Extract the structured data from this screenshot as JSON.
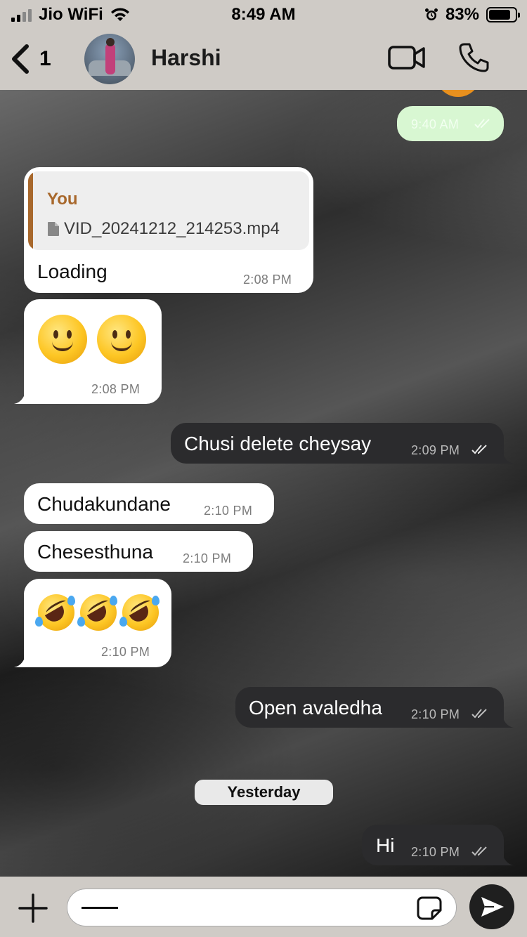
{
  "status_bar": {
    "carrier": "Jio WiFi",
    "time": "8:49 AM",
    "battery_percent": "83%",
    "battery_level": 0.83
  },
  "header": {
    "back_count": "1",
    "contact_name": "Harshi"
  },
  "messages": [
    {
      "direction": "out",
      "text": "",
      "time": "9:40 AM",
      "ticks": "read"
    },
    {
      "direction": "in",
      "reply_to": {
        "author": "You",
        "file_icon": "document-icon",
        "file_name": "VID_20241212_214253.mp4"
      },
      "text": "Loading",
      "time": "2:08 PM"
    },
    {
      "direction": "in",
      "emoji": [
        "slightly-smiling-face",
        "slightly-smiling-face"
      ],
      "time": "2:08 PM"
    },
    {
      "direction": "out",
      "text": "Chusi delete cheysay",
      "time": "2:09 PM",
      "ticks": "delivered"
    },
    {
      "direction": "in",
      "text": "Chudakundane",
      "time": "2:10 PM"
    },
    {
      "direction": "in",
      "text": "Chesesthuna",
      "time": "2:10 PM"
    },
    {
      "direction": "in",
      "emoji": [
        "rolling-on-the-floor-laughing",
        "rolling-on-the-floor-laughing",
        "rolling-on-the-floor-laughing"
      ],
      "time": "2:10 PM"
    },
    {
      "direction": "out",
      "text": "Open avaledha",
      "time": "2:10 PM",
      "ticks": "delivered"
    },
    {
      "direction": "out",
      "text": "Hi",
      "time": "2:10 PM",
      "ticks": "delivered"
    }
  ],
  "date_separator": "Yesterday",
  "composer": {
    "value": "",
    "icons": [
      "plus-icon",
      "sticker-icon",
      "send-icon"
    ]
  },
  "colors": {
    "bars": "#cfcbc6",
    "incoming_bubble": "#ffffff",
    "outgoing_bubble": "#2b2b2d",
    "reply_accent": "#a8682c",
    "highlight_bubble": "#d8f7d2"
  }
}
